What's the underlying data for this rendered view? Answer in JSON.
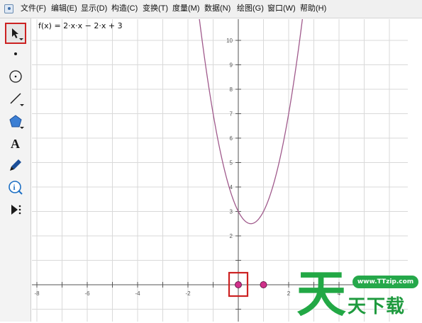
{
  "menu": {
    "items": [
      {
        "label": "文件(F)"
      },
      {
        "label": "编辑(E)"
      },
      {
        "label": "显示(D)"
      },
      {
        "label": "构造(C)"
      },
      {
        "label": "变换(T)"
      },
      {
        "label": "度量(M)"
      },
      {
        "label": "数据(N)"
      },
      {
        "label": "绘图(G)"
      },
      {
        "label": "窗口(W)"
      },
      {
        "label": "帮助(H)"
      }
    ]
  },
  "toolbox": {
    "tools": [
      {
        "icon": "arrow-select-icon",
        "selected": true,
        "more": true
      },
      {
        "icon": "point-tool-icon",
        "selected": false,
        "more": false
      },
      {
        "icon": "compass-circle-icon",
        "selected": false,
        "more": false
      },
      {
        "icon": "straightedge-line-icon",
        "selected": false,
        "more": true
      },
      {
        "icon": "polygon-tool-icon",
        "selected": false,
        "more": true
      },
      {
        "icon": "text-tool-icon",
        "selected": false,
        "more": false
      },
      {
        "icon": "marker-pen-icon",
        "selected": false,
        "more": false
      },
      {
        "icon": "information-icon",
        "selected": false,
        "more": false
      },
      {
        "icon": "custom-tool-icon",
        "selected": false,
        "more": false
      }
    ]
  },
  "graph": {
    "function_label": "f(x) = 2·x·x − 2·x + 3",
    "x_tick_labels": [
      "-8",
      "-6",
      "-4",
      "-2",
      "2",
      "4"
    ],
    "y_tick_labels": [
      "2",
      "3",
      "4",
      "5",
      "6",
      "7",
      "8",
      "9",
      "10"
    ],
    "points": [
      {
        "x": 0,
        "y": 0,
        "highlighted": true
      },
      {
        "x": 1,
        "y": 0,
        "highlighted": false
      }
    ],
    "curve_color": "#a05a8c",
    "point_color": "#d0308a",
    "highlight_color": "#cc2222"
  },
  "watermark": {
    "logo": "天",
    "url": "www.TTzip.com",
    "text": "天下载"
  }
}
